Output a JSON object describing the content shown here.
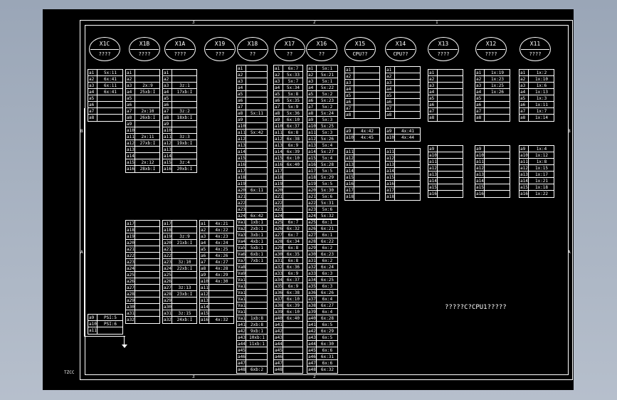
{
  "connectors": [
    {
      "id": "x1c",
      "name": "X1C",
      "sub": "????"
    },
    {
      "id": "x1b",
      "name": "X1B",
      "sub": "????"
    },
    {
      "id": "x1a",
      "name": "X1A",
      "sub": "????"
    },
    {
      "id": "x19",
      "name": "X19",
      "sub": "???"
    },
    {
      "id": "x18",
      "name": "X18",
      "sub": "??"
    },
    {
      "id": "x17",
      "name": "X17",
      "sub": "??"
    },
    {
      "id": "x16",
      "name": "X16",
      "sub": "??"
    },
    {
      "id": "x15",
      "name": "X15",
      "sub": "CPU??"
    },
    {
      "id": "x14",
      "name": "X14",
      "sub": "CPU??"
    },
    {
      "id": "x13",
      "name": "X13",
      "sub": "????"
    },
    {
      "id": "x12",
      "name": "X12",
      "sub": "????"
    },
    {
      "id": "x11",
      "name": "X11",
      "sub": "????"
    }
  ],
  "tables": [
    {
      "id": "x1c-top",
      "rows": [
        [
          "a1",
          "5x:11"
        ],
        [
          "a2",
          "6x:41"
        ],
        [
          "a3",
          "6x:11"
        ],
        [
          "a4",
          "6x:41"
        ],
        [
          "a5",
          ""
        ],
        [
          "a6",
          ""
        ],
        [
          "a7",
          ""
        ],
        [
          "a8",
          ""
        ]
      ]
    },
    {
      "id": "x1c-bot",
      "rows": [
        [
          "a9",
          "PSI:5"
        ],
        [
          "a10",
          "PSI:6"
        ],
        [
          "a11",
          ""
        ]
      ]
    },
    {
      "id": "x1b-top",
      "rows": [
        [
          "a1",
          ""
        ],
        [
          "a2",
          ""
        ],
        [
          "a3",
          "2x:9"
        ],
        [
          "a4",
          "25xb:I"
        ],
        [
          "a5",
          ""
        ],
        [
          "a6",
          ""
        ],
        [
          "a7",
          "2x:10"
        ],
        [
          "a8",
          "26xb:I"
        ],
        [
          "a9",
          ""
        ],
        [
          "a10",
          ""
        ],
        [
          "a11",
          "2x:11"
        ],
        [
          "a12",
          "27xb:I"
        ],
        [
          "a13",
          ""
        ],
        [
          "a14",
          ""
        ],
        [
          "a15",
          "2x:12"
        ],
        [
          "a16",
          "28xb:I"
        ]
      ]
    },
    {
      "id": "x1b-bot",
      "rows": [
        [
          "a17",
          ""
        ],
        [
          "a18",
          ""
        ],
        [
          "a19",
          ""
        ],
        [
          "a20",
          ""
        ],
        [
          "a21",
          ""
        ],
        [
          "a22",
          ""
        ],
        [
          "a23",
          ""
        ],
        [
          "a24",
          ""
        ],
        [
          "a25",
          ""
        ],
        [
          "a26",
          ""
        ],
        [
          "a27",
          ""
        ],
        [
          "a28",
          ""
        ],
        [
          "a29",
          ""
        ],
        [
          "a30",
          ""
        ],
        [
          "a31",
          ""
        ],
        [
          "a32",
          ""
        ]
      ]
    },
    {
      "id": "x1a-top",
      "rows": [
        [
          "a1",
          ""
        ],
        [
          "a2",
          ""
        ],
        [
          "a3",
          "3z:1"
        ],
        [
          "a4",
          "17xb:I"
        ],
        [
          "a5",
          ""
        ],
        [
          "a6",
          ""
        ],
        [
          "a7",
          "3z:2"
        ],
        [
          "a8",
          "18xb:I"
        ],
        [
          "a9",
          ""
        ],
        [
          "a10",
          ""
        ],
        [
          "a11",
          "3z:3"
        ],
        [
          "a12",
          "19xb:I"
        ],
        [
          "a13",
          ""
        ],
        [
          "a14",
          ""
        ],
        [
          "a15",
          "3z:4"
        ],
        [
          "a16",
          "20xb:I"
        ]
      ]
    },
    {
      "id": "x1a-bot",
      "rows": [
        [
          "a17",
          ""
        ],
        [
          "a18",
          ""
        ],
        [
          "a19",
          "3z:9"
        ],
        [
          "a20",
          "21xb:I"
        ],
        [
          "a21",
          ""
        ],
        [
          "a22",
          ""
        ],
        [
          "a23",
          "3z:10"
        ],
        [
          "a24",
          "22xb:I"
        ],
        [
          "a25",
          ""
        ],
        [
          "a26",
          ""
        ],
        [
          "a27",
          "3z:13"
        ],
        [
          "a28",
          "23xb:I"
        ],
        [
          "a29",
          ""
        ],
        [
          "a30",
          ""
        ],
        [
          "a31",
          "3z:15"
        ],
        [
          "a32",
          "24xb:I"
        ]
      ]
    },
    {
      "id": "x19-bot",
      "rows": [
        [
          "a1",
          "4x:21"
        ],
        [
          "a2",
          "4x:22"
        ],
        [
          "a3",
          "4x:23"
        ],
        [
          "a4",
          "4x:24"
        ],
        [
          "a5",
          "4x:25"
        ],
        [
          "a6",
          "4x:26"
        ],
        [
          "a7",
          "4x:27"
        ],
        [
          "a8",
          "4x:28"
        ],
        [
          "a9",
          "4x:29"
        ],
        [
          "a10",
          "4x:30"
        ],
        [
          "a11",
          ""
        ],
        [
          "a12",
          ""
        ],
        [
          "a13",
          ""
        ],
        [
          "a14",
          ""
        ],
        [
          "a15",
          ""
        ],
        [
          "a16",
          "4x:32"
        ]
      ]
    },
    {
      "id": "x18-top",
      "rows": [
        [
          "a1",
          ""
        ],
        [
          "a2",
          ""
        ],
        [
          "a3",
          ""
        ],
        [
          "a4",
          ""
        ],
        [
          "a5",
          ""
        ],
        [
          "a6",
          ""
        ],
        [
          "a7",
          ""
        ],
        [
          "a8",
          "5x:11"
        ],
        [
          "a9",
          ""
        ],
        [
          "a10",
          ""
        ],
        [
          "a11",
          "5x:42"
        ],
        [
          "a12",
          ""
        ],
        [
          "a13",
          ""
        ],
        [
          "a14",
          ""
        ],
        [
          "a15",
          ""
        ],
        [
          "a16",
          ""
        ],
        [
          "a17",
          ""
        ],
        [
          "a18",
          ""
        ],
        [
          "a19",
          ""
        ],
        [
          "a20",
          "6x:11"
        ],
        [
          "a21",
          ""
        ],
        [
          "a22",
          ""
        ],
        [
          "a23",
          ""
        ],
        [
          "a24",
          "6x:42"
        ]
      ]
    },
    {
      "id": "x18-bot",
      "rows": [
        [
          "Va1",
          "1xb:1"
        ],
        [
          "Va2",
          "2xb:1"
        ],
        [
          "Va3",
          "3xb:1"
        ],
        [
          "Va4",
          "4xb:1"
        ],
        [
          "Va5",
          "5xb:1"
        ],
        [
          "Va6",
          "6xb:1"
        ],
        [
          "Va7",
          "7xb:1"
        ],
        [
          "Va8",
          ""
        ],
        [
          "Va9",
          ""
        ],
        [
          "Va10",
          ""
        ],
        [
          "Va11",
          ""
        ],
        [
          "Va12",
          ""
        ],
        [
          "Va13",
          ""
        ],
        [
          "Va14",
          ""
        ],
        [
          "Va15",
          ""
        ],
        [
          "Va16",
          "1xb:8"
        ],
        [
          "a41",
          "2xb:8"
        ],
        [
          "a42",
          "9xb:1"
        ],
        [
          "a43",
          "10xb:1"
        ],
        [
          "a44",
          "11xb:1"
        ],
        [
          "a45",
          ""
        ],
        [
          "a46",
          ""
        ],
        [
          "a47",
          ""
        ],
        [
          "a48",
          "6xb:2"
        ]
      ]
    },
    {
      "id": "x17-top",
      "rows": [
        [
          "a1",
          "6x:7"
        ],
        [
          "a2",
          "5x:33"
        ],
        [
          "a3",
          "5x:7"
        ],
        [
          "a4",
          "5x:34"
        ],
        [
          "a5",
          "5x:8"
        ],
        [
          "a6",
          "5x:35"
        ],
        [
          "a7",
          "5x:9"
        ],
        [
          "a8",
          "5x:36"
        ],
        [
          "a9",
          "6x:10"
        ],
        [
          "a10",
          "6x:37"
        ],
        [
          "a11",
          "6x:8"
        ],
        [
          "a12",
          "6x:38"
        ],
        [
          "a13",
          "6x:9"
        ],
        [
          "a14",
          "6x:39"
        ],
        [
          "a15",
          "6x:10"
        ],
        [
          "a16",
          "6x:40"
        ],
        [
          "a17",
          ""
        ],
        [
          "a18",
          ""
        ],
        [
          "a19",
          ""
        ],
        [
          "a20",
          ""
        ],
        [
          "a21",
          ""
        ],
        [
          "a22",
          ""
        ],
        [
          "a23",
          ""
        ],
        [
          "a24",
          ""
        ]
      ]
    },
    {
      "id": "x17-bot",
      "rows": [
        [
          "a25",
          "6x:7"
        ],
        [
          "a26",
          "6x:32"
        ],
        [
          "a27",
          "6x:7"
        ],
        [
          "a28",
          "6x:34"
        ],
        [
          "a29",
          "6x:8"
        ],
        [
          "a30",
          "6x:35"
        ],
        [
          "a31",
          "6x:8"
        ],
        [
          "a32",
          "6x:36"
        ],
        [
          "a33",
          "6x:9"
        ],
        [
          "a34",
          "6x:37"
        ],
        [
          "a35",
          "6x:9"
        ],
        [
          "a36",
          "6x:38"
        ],
        [
          "a37",
          "6x:10"
        ],
        [
          "a38",
          "6x:39"
        ],
        [
          "a39",
          "6x:10"
        ],
        [
          "a40",
          "6x:40"
        ],
        [
          "a41",
          ""
        ],
        [
          "a42",
          ""
        ],
        [
          "a43",
          ""
        ],
        [
          "a44",
          ""
        ],
        [
          "a45",
          ""
        ],
        [
          "a46",
          ""
        ],
        [
          "a47",
          ""
        ],
        [
          "a48",
          ""
        ]
      ]
    },
    {
      "id": "x16-top",
      "rows": [
        [
          "a1",
          "5x:1"
        ],
        [
          "a2",
          "5x:21"
        ],
        [
          "a3",
          "5x:1"
        ],
        [
          "a4",
          "5x:22"
        ],
        [
          "a5",
          "5x:2"
        ],
        [
          "a6",
          "5x:23"
        ],
        [
          "a7",
          "5x:2"
        ],
        [
          "a8",
          "5x:24"
        ],
        [
          "a9",
          "5x:3"
        ],
        [
          "a10",
          "5x:25"
        ],
        [
          "a11",
          "5x:3"
        ],
        [
          "a12",
          "5x:26"
        ],
        [
          "a13",
          "5x:4"
        ],
        [
          "a14",
          "5x:27"
        ],
        [
          "a15",
          "5x:4"
        ],
        [
          "a16",
          "5x:28"
        ],
        [
          "a17",
          "5x:5"
        ],
        [
          "a18",
          "5x:29"
        ],
        [
          "a19",
          "5x:5"
        ],
        [
          "a20",
          "5x:30"
        ],
        [
          "a21",
          "5x:6"
        ],
        [
          "a22",
          "5x:31"
        ],
        [
          "a23",
          "5x:6"
        ],
        [
          "a24",
          "5x:32"
        ]
      ]
    },
    {
      "id": "x16-bot",
      "rows": [
        [
          "a25",
          "6x:1"
        ],
        [
          "a26",
          "6x:21"
        ],
        [
          "a27",
          "6x:1"
        ],
        [
          "a28",
          "6x:22"
        ],
        [
          "a29",
          "6x:2"
        ],
        [
          "a30",
          "6x:23"
        ],
        [
          "a31",
          "6x:2"
        ],
        [
          "a32",
          "6x:24"
        ],
        [
          "a33",
          "6x:3"
        ],
        [
          "a34",
          "6x:25"
        ],
        [
          "a35",
          "6x:3"
        ],
        [
          "a36",
          "6x:26"
        ],
        [
          "a37",
          "6x:4"
        ],
        [
          "a38",
          "6x:27"
        ],
        [
          "a39",
          "6x:4"
        ],
        [
          "a40",
          "6x:28"
        ],
        [
          "a41",
          "6x:5"
        ],
        [
          "a42",
          "6x:29"
        ],
        [
          "a43",
          "6x:5"
        ],
        [
          "a44",
          "6x:30"
        ],
        [
          "a45",
          "6x:6"
        ],
        [
          "a46",
          "6x:31"
        ],
        [
          "a47",
          "6x:6"
        ],
        [
          "a48",
          "6x:32"
        ]
      ]
    },
    {
      "id": "x15-top",
      "rows": [
        [
          "a1",
          ""
        ],
        [
          "a2",
          ""
        ],
        [
          "a3",
          ""
        ],
        [
          "a4",
          ""
        ],
        [
          "a5",
          ""
        ],
        [
          "a6",
          ""
        ],
        [
          "a7",
          ""
        ],
        [
          "a8",
          ""
        ]
      ]
    },
    {
      "id": "x15-mid",
      "rows": [
        [
          "a9",
          "4x:42"
        ],
        [
          "a10",
          "4x:45"
        ]
      ]
    },
    {
      "id": "x15-bot",
      "rows": [
        [
          "a11",
          ""
        ],
        [
          "a12",
          ""
        ],
        [
          "a13",
          ""
        ],
        [
          "a14",
          ""
        ],
        [
          "a15",
          ""
        ],
        [
          "a16",
          ""
        ],
        [
          "a17",
          ""
        ],
        [
          "a18",
          ""
        ]
      ]
    },
    {
      "id": "x14-top",
      "rows": [
        [
          "a1",
          ""
        ],
        [
          "a2",
          ""
        ],
        [
          "a3",
          ""
        ],
        [
          "a4",
          ""
        ],
        [
          "a5",
          ""
        ],
        [
          "a6",
          ""
        ],
        [
          "a7",
          ""
        ],
        [
          "a8",
          ""
        ]
      ]
    },
    {
      "id": "x14-mid",
      "rows": [
        [
          "a9",
          "4x:41"
        ],
        [
          "a10",
          "4x:44"
        ]
      ]
    },
    {
      "id": "x14-bot",
      "rows": [
        [
          "a11",
          ""
        ],
        [
          "a12",
          ""
        ],
        [
          "a13",
          ""
        ],
        [
          "a14",
          ""
        ],
        [
          "a15",
          ""
        ],
        [
          "a16",
          ""
        ],
        [
          "a17",
          ""
        ],
        [
          "a18",
          ""
        ]
      ]
    },
    {
      "id": "x13-top",
      "rows": [
        [
          "a1",
          ""
        ],
        [
          "a2",
          ""
        ],
        [
          "a3",
          ""
        ],
        [
          "a4",
          ""
        ],
        [
          "a5",
          ""
        ],
        [
          "a6",
          ""
        ],
        [
          "a7",
          ""
        ],
        [
          "a8",
          ""
        ]
      ]
    },
    {
      "id": "x13-bot",
      "rows": [
        [
          "a9",
          ""
        ],
        [
          "a10",
          ""
        ],
        [
          "a11",
          ""
        ],
        [
          "a12",
          ""
        ],
        [
          "a13",
          ""
        ],
        [
          "a14",
          ""
        ],
        [
          "a15",
          ""
        ],
        [
          "a16",
          ""
        ]
      ]
    },
    {
      "id": "x12-top",
      "rows": [
        [
          "a1",
          "1x:19"
        ],
        [
          "a2",
          "1x:23"
        ],
        [
          "a3",
          "1x:25"
        ],
        [
          "a4",
          "1x:26"
        ],
        [
          "a5",
          ""
        ],
        [
          "a6",
          ""
        ],
        [
          "a7",
          ""
        ],
        [
          "a8",
          ""
        ]
      ]
    },
    {
      "id": "x12-bot",
      "rows": [
        [
          "a9",
          ""
        ],
        [
          "a10",
          ""
        ],
        [
          "a11",
          ""
        ],
        [
          "a12",
          ""
        ],
        [
          "a13",
          ""
        ],
        [
          "a14",
          ""
        ],
        [
          "a15",
          ""
        ],
        [
          "a16",
          ""
        ]
      ]
    },
    {
      "id": "x11-top",
      "rows": [
        [
          "a1",
          "1x:2"
        ],
        [
          "a2",
          "1x:10"
        ],
        [
          "a3",
          "1x:6"
        ],
        [
          "a4",
          "1x:13"
        ],
        [
          "a5",
          "1x:3"
        ],
        [
          "a6",
          "1x:11"
        ],
        [
          "a7",
          "1x:7"
        ],
        [
          "a8",
          "1x:14"
        ]
      ]
    },
    {
      "id": "x11-bot",
      "rows": [
        [
          "a9",
          "1x:4"
        ],
        [
          "a10",
          "1x:12"
        ],
        [
          "a11",
          "1x:8"
        ],
        [
          "a12",
          "1x:15"
        ],
        [
          "a13",
          "1x:17"
        ],
        [
          "a14",
          "1x:21"
        ],
        [
          "a15",
          "1x:18"
        ],
        [
          "a16",
          "1x:22"
        ]
      ]
    }
  ],
  "frame_marks": {
    "top": [
      "3",
      "2",
      "1"
    ],
    "bottom": [
      "3",
      "2"
    ],
    "left": [
      "B",
      "A"
    ],
    "right": [
      "B",
      "A"
    ]
  },
  "note": "?????C?CPU1?????",
  "stamp": "TZCC"
}
